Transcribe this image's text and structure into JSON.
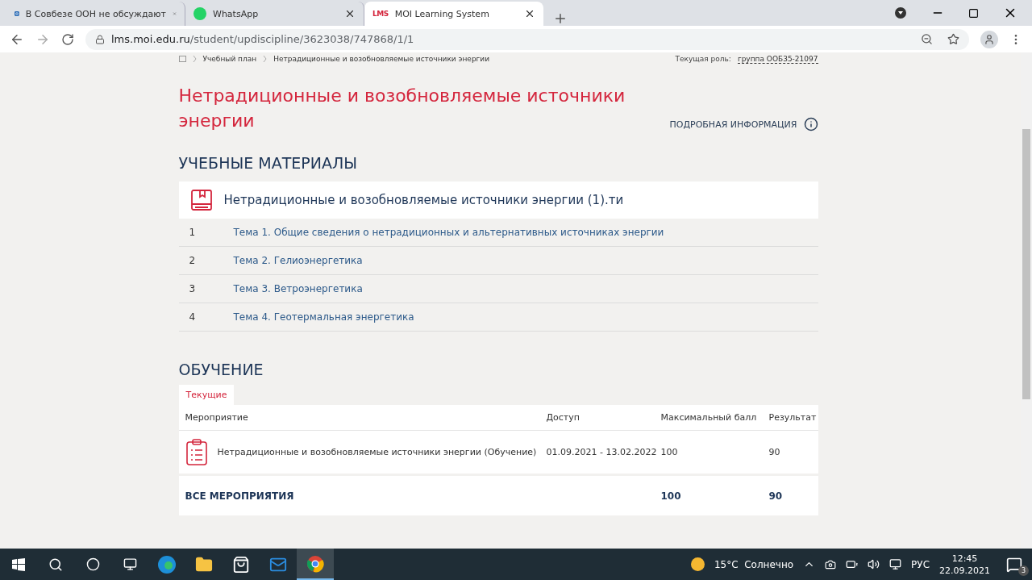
{
  "browser": {
    "tabs": [
      {
        "title": "В Совбезе ООН не обсуждают",
        "selected": false,
        "kind": "mail"
      },
      {
        "title": "WhatsApp",
        "selected": false,
        "kind": "whatsapp"
      },
      {
        "title": "MOI Learning System",
        "selected": true,
        "kind": "lms",
        "favicon": "LMS"
      }
    ],
    "url_host": "lms.moi.edu.ru",
    "url_path": "/student/updiscipline/3623038/747868/1/1"
  },
  "breadcrumbs": [
    "Учебный план",
    "Нетрадиционные и возобновляемые источники энергии"
  ],
  "role": {
    "label": "Текущая роль:",
    "value": "группа ООБ35-21097"
  },
  "title": "Нетрадиционные и возобновляемые источники энергии",
  "details_link": "ПОДРОБНАЯ ИНФОРМАЦИЯ",
  "materials": {
    "heading": "УЧЕБНЫЕ МАТЕРИАЛЫ",
    "course": "Нетрадиционные и возобновляемые источники энергии (1).ти",
    "topics": [
      {
        "number": "1",
        "title": "Тема 1. Общие сведения о нетрадиционных и альтернативных источниках энергии"
      },
      {
        "number": "2",
        "title": "Тема 2. Гелиоэнергетика"
      },
      {
        "number": "3",
        "title": "Тема 3. Ветроэнергетика"
      },
      {
        "number": "4",
        "title": "Тема 4. Геотермальная энергетика"
      }
    ]
  },
  "learning": {
    "heading": "ОБУЧЕНИЕ",
    "tabs": [
      {
        "label": "Текущие",
        "selected": true
      }
    ],
    "columns": [
      "Мероприятие",
      "Доступ",
      "Максимальный балл",
      "Результат"
    ],
    "rows": [
      {
        "activity": "Нетрадиционные и возобновляемые источники энергии (Обучение)",
        "access": "01.09.2021 - 13.02.2022",
        "max": "100",
        "result": "90"
      }
    ],
    "total": {
      "label": "ВСЕ МЕРОПРИЯТИЯ",
      "max": "100",
      "result": "90"
    }
  },
  "taskbar": {
    "weather": "15°C  Солнечно",
    "language": "РУС",
    "time": "12:45",
    "date": "22.09.2021",
    "notifications": "3"
  }
}
